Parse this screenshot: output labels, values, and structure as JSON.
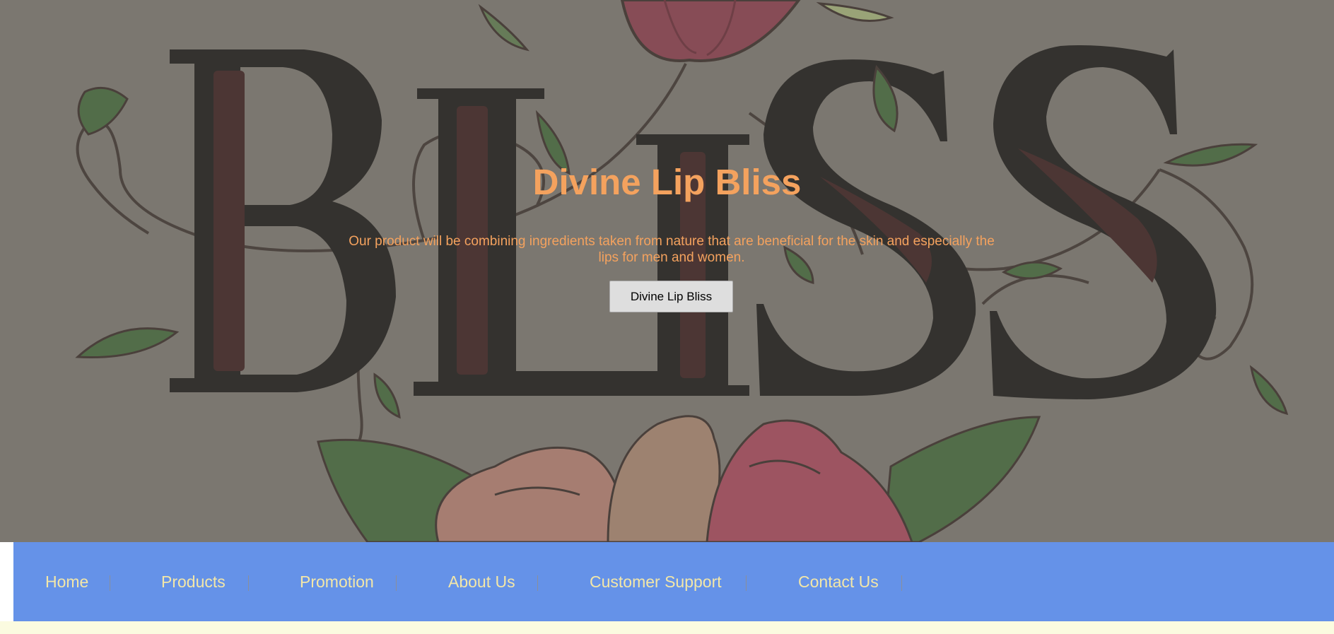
{
  "hero": {
    "title": "Divine Lip Bliss",
    "description": "Our product will be combining ingredients taken from nature that are beneficial for the skin and especially the lips for men and women.",
    "button_label": "Divine Lip Bliss",
    "background_text": "BLISS"
  },
  "nav": {
    "items": [
      {
        "label": "Home"
      },
      {
        "label": "Products"
      },
      {
        "label": "Promotion"
      },
      {
        "label": "About Us"
      },
      {
        "label": "Customer Support"
      },
      {
        "label": "Contact Us"
      }
    ]
  },
  "colors": {
    "hero_bg": "#7b7770",
    "accent_text": "#f4a25e",
    "nav_bg": "#6592e8",
    "nav_text": "#f3e7a8",
    "page_bg": "#fbfbe0"
  }
}
